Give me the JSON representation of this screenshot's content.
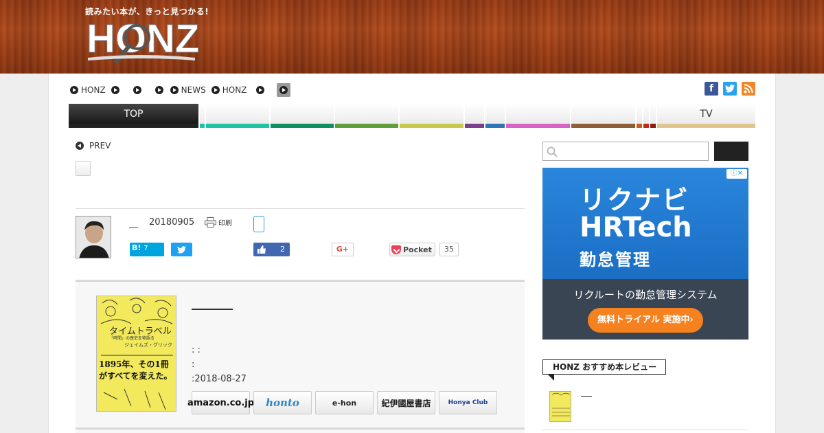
{
  "header": {
    "tagline": "読みたい本が、きっと見つかる!",
    "logo_text": "HONZ"
  },
  "breadcrumbs": [
    "HONZ",
    "",
    "",
    "",
    "NEWS",
    "HONZ",
    "",
    ""
  ],
  "social": {
    "facebook": "f",
    "twitter": "t",
    "rss": "rss"
  },
  "nav": {
    "tabs": [
      {
        "label": "TOP",
        "color": "#222222",
        "active": true
      },
      {
        "label": "",
        "color": "#1ec4a4"
      },
      {
        "label": "",
        "color": "#1ec4a4"
      },
      {
        "label": "",
        "color": "#0e8f5f"
      },
      {
        "label": "",
        "color": "#5f9e3a"
      },
      {
        "label": "",
        "color": "#c8c94a"
      },
      {
        "label": "",
        "color": "#7b3f8a"
      },
      {
        "label": "",
        "color": "#2f74b5"
      },
      {
        "label": "",
        "color": "#d763c4"
      },
      {
        "label": "",
        "color": "#8e5e36"
      },
      {
        "label": "",
        "color": "#c8601b"
      },
      {
        "label": "",
        "color": "#c8251b"
      },
      {
        "label": "",
        "color": "#8b1a13"
      },
      {
        "label": "TV",
        "color": "#e2c48e"
      }
    ]
  },
  "article": {
    "prev_label": "PREV",
    "author_name": "__",
    "date": "20180905",
    "print_label": "印刷"
  },
  "share": {
    "hatena_label": "B!",
    "hatena_count": "7",
    "like_count": "2",
    "gplus_label": "G+",
    "pocket_label": "Pocket",
    "pocket_count": "35"
  },
  "book": {
    "cover_title": "タイムトラベル",
    "cover_subtitle": "「時間」の歴史を物語る",
    "cover_author": "ジェイムズ・グリック",
    "cover_tagline": "1895年、その1冊がすべてを変えた。",
    "meta_line1": ": :",
    "meta_line2": ":",
    "meta_date": ":2018-08-27",
    "stores": [
      "amazon.co.jp",
      "honto",
      "e-hon",
      "紀伊國屋書店",
      "Honya Club"
    ]
  },
  "ad": {
    "line1": "リクナビ",
    "line2": "HRTech",
    "line3": "勤怠管理",
    "line4": "リクルートの勤怠管理システム",
    "cta": "無料トライアル 実施中›"
  },
  "sidebar": {
    "section_label": "HONZ おすすめ本レビュー",
    "item_dash": "—"
  }
}
